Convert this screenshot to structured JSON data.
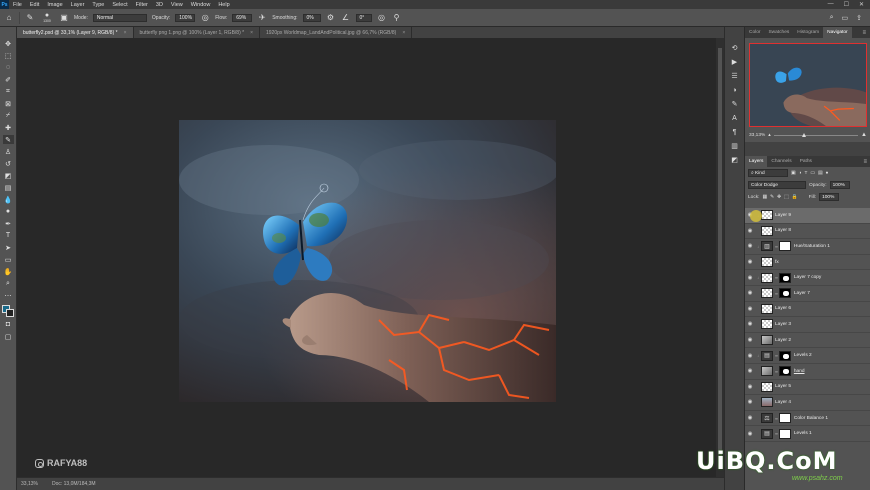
{
  "menubar": {
    "logo": "Ps",
    "items": [
      "File",
      "Edit",
      "Image",
      "Layer",
      "Type",
      "Select",
      "Filter",
      "3D",
      "View",
      "Window",
      "Help"
    ],
    "controls": [
      "—",
      "☐",
      "✕"
    ]
  },
  "options": {
    "brush_size": "1300",
    "mode_label": "Mode:",
    "mode_value": "Normal",
    "opacity_label": "Opacity:",
    "opacity_value": "100%",
    "flow_label": "Flow:",
    "flow_value": "69%",
    "smoothing_label": "Smoothing:",
    "smoothing_value": "0%",
    "angle_value": "0°"
  },
  "tabs": [
    {
      "label": "butterfly2.psd @ 33,1% (Layer 9, RGB/8) *",
      "close": "×"
    },
    {
      "label": "butterfly png 1.png @ 100% (Layer 1, RGB/8) *",
      "close": "×"
    },
    {
      "label": "1920px Worldmap_LandAndPolitical.jpg @ 66,7% (RGB/8)",
      "close": "×"
    }
  ],
  "status": {
    "zoom": "33,13%",
    "doc": "Doc: 13,0M/184,3M"
  },
  "watermark_user": "RAFYA88",
  "site_watermark": "UiBQ.CoM",
  "site_sub": "www.psahz.com",
  "panel_tabs": [
    "Color",
    "Swatches",
    "Histogram",
    "Navigator"
  ],
  "navigator": {
    "zoom": "33,13%"
  },
  "layers_panel": {
    "tabs": [
      "Layers",
      "Channels",
      "Paths"
    ],
    "kind_value": "Kind",
    "blend_value": "Color Dodge",
    "opacity_label": "Opacity:",
    "opacity_value": "100%",
    "lock_label": "Lock:",
    "fill_label": "Fill:",
    "fill_value": "100%",
    "layers": [
      {
        "name": "Layer 9",
        "thumb": "checker",
        "mask": "",
        "selected": true
      },
      {
        "name": "Layer 8",
        "thumb": "checker",
        "mask": "",
        "selected": false
      },
      {
        "name": "Hue/Saturation 1",
        "thumb": "adj",
        "mask": "white",
        "selected": false
      },
      {
        "name": "fx",
        "thumb": "checker",
        "mask": "",
        "selected": false
      },
      {
        "name": "Layer 7 copy",
        "thumb": "checker",
        "mask": "black",
        "selected": false
      },
      {
        "name": "Layer 7",
        "thumb": "checker",
        "mask": "black",
        "selected": false
      },
      {
        "name": "Layer 6",
        "thumb": "checker",
        "mask": "",
        "selected": false
      },
      {
        "name": "Layer 3",
        "thumb": "checker",
        "mask": "",
        "selected": false
      },
      {
        "name": "Layer 2",
        "thumb": "photo",
        "mask": "",
        "selected": false
      },
      {
        "name": "Levels 2",
        "thumb": "adj",
        "mask": "black",
        "selected": false
      },
      {
        "name": "hand",
        "thumb": "photo",
        "mask": "black",
        "selected": false
      },
      {
        "name": "Layer 5",
        "thumb": "checker",
        "mask": "",
        "selected": false
      },
      {
        "name": "Layer 4",
        "thumb": "sky",
        "mask": "",
        "selected": false
      },
      {
        "name": "Color Balance 1",
        "thumb": "adj",
        "mask": "white",
        "selected": false
      },
      {
        "name": "Levels 1",
        "thumb": "adj",
        "mask": "white",
        "selected": false
      }
    ]
  }
}
